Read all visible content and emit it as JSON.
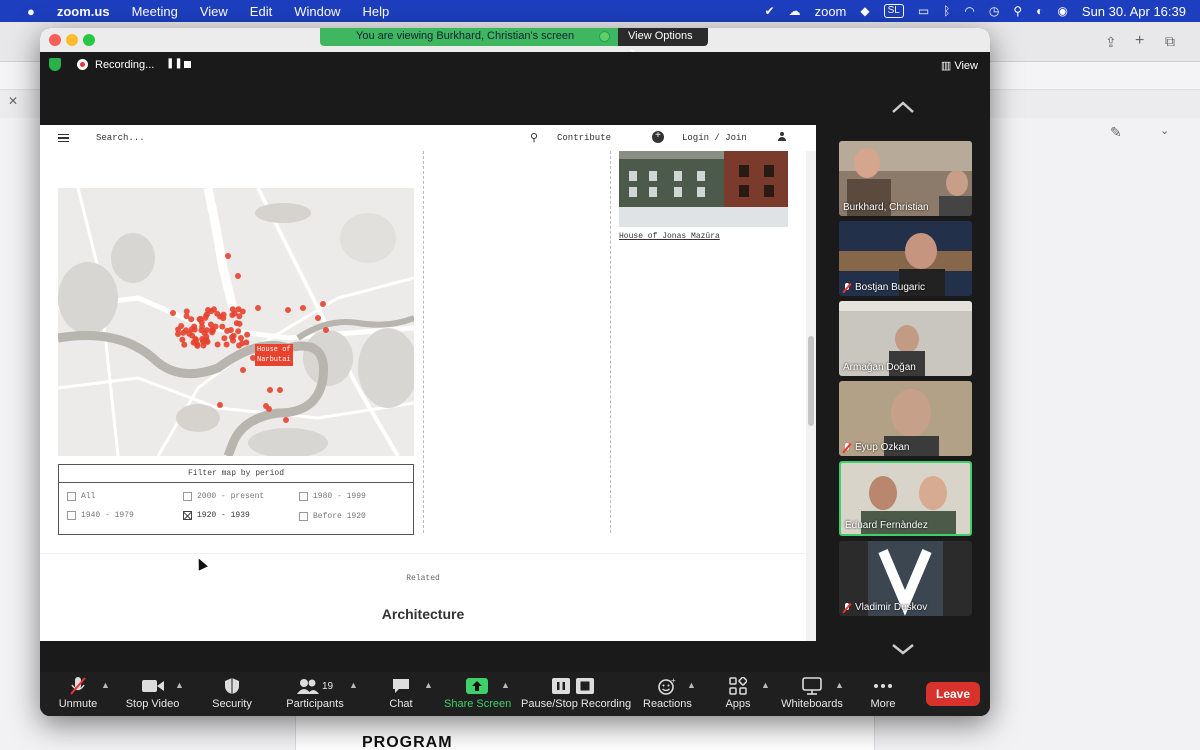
{
  "menubar": {
    "app": "zoom.us",
    "items": [
      "Meeting",
      "View",
      "Edit",
      "Window",
      "Help"
    ],
    "status_zoom": "zoom",
    "status_sl": "SL",
    "datetime": "Sun 30. Apr  16:39"
  },
  "background": {
    "program_heading": "PROGRAM"
  },
  "zoom": {
    "viewing_banner": "You are viewing Burkhard, Christian's screen",
    "view_options": "View Options",
    "recording_label": "Recording...",
    "view_button": "View"
  },
  "site": {
    "search_placeholder": "Search...",
    "contribute": "Contribute",
    "login": "Login / Join",
    "map_tooltip_line1": "House of",
    "map_tooltip_line2": "Narbutai",
    "filter_title": "Filter map by period",
    "filter_options": [
      {
        "label": "All",
        "checked": false
      },
      {
        "label": "2000 - present",
        "checked": false
      },
      {
        "label": "1980 - 1999",
        "checked": false
      },
      {
        "label": "1940 - 1979",
        "checked": false
      },
      {
        "label": "1920 - 1939",
        "checked": true
      },
      {
        "label": "Before 1920",
        "checked": false
      }
    ],
    "house_caption": "House of Jonas Mazūra",
    "related": "Related",
    "section_title": "Architecture"
  },
  "participants": [
    {
      "name": "Burkhard, Christian",
      "muted": false,
      "active": false
    },
    {
      "name": "Bostjan Bugaric",
      "muted": true,
      "active": false
    },
    {
      "name": "Armağan Doğan",
      "muted": false,
      "active": false
    },
    {
      "name": "Eyup Ozkan",
      "muted": true,
      "active": false
    },
    {
      "name": "Eduard Fernàndez",
      "muted": false,
      "active": true
    },
    {
      "name": "Vladimir Deskov",
      "muted": true,
      "active": false
    }
  ],
  "toolbar": {
    "unmute": "Unmute",
    "stop_video": "Stop Video",
    "security": "Security",
    "participants": "Participants",
    "participants_count": "19",
    "chat": "Chat",
    "share_screen": "Share Screen",
    "pause_stop_recording": "Pause/Stop Recording",
    "reactions": "Reactions",
    "apps": "Apps",
    "whiteboards": "Whiteboards",
    "more": "More",
    "leave": "Leave"
  },
  "colors": {
    "accent_green": "#3fd06a",
    "leave_red": "#d7322c",
    "map_marker_red": "#e8432f"
  }
}
